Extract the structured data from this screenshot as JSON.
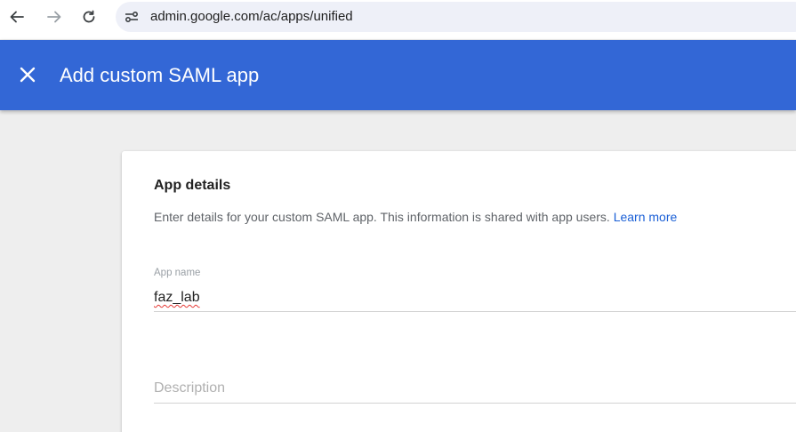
{
  "browser": {
    "url": "admin.google.com/ac/apps/unified",
    "icons": [
      "back-arrow-icon",
      "forward-arrow-icon",
      "reload-icon",
      "site-settings-icon"
    ]
  },
  "header": {
    "title": "Add custom SAML app",
    "close_icon": "close-icon",
    "background_color": "#3367d6"
  },
  "card": {
    "section_title": "App details",
    "description": "Enter details for your custom SAML app. This information is shared with app users. ",
    "learn_more": "Learn more",
    "app_name": {
      "label": "App name",
      "value": "faz_lab"
    },
    "description_field": {
      "placeholder": "Description",
      "value": ""
    }
  },
  "colors": {
    "accent": "#3367d6",
    "link": "#1a5fd6",
    "page_background": "#eeeeee"
  }
}
